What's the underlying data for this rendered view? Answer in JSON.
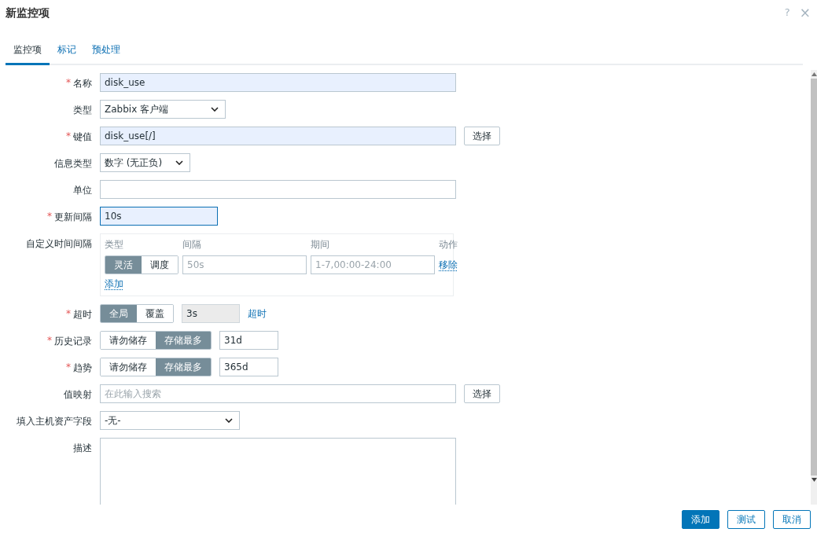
{
  "dialog": {
    "title": "新监控项",
    "help": "?",
    "close": "×"
  },
  "tabs": [
    {
      "label": "监控项",
      "selected": true
    },
    {
      "label": "标记",
      "selected": false
    },
    {
      "label": "预处理",
      "selected": false
    }
  ],
  "fields": [
    {
      "kind": "text",
      "label": "名称",
      "required_mark": "*",
      "value": "disk_use",
      "autofilled": true,
      "focused": false
    },
    {
      "kind": "select",
      "label": "类型",
      "value": "Zabbix 客户端"
    },
    {
      "kind": "text",
      "label": "键值",
      "required_mark": "*",
      "value": "disk_use[/]",
      "autofilled": true,
      "focused": false,
      "button": "选择"
    },
    {
      "kind": "select",
      "label": "信息类型",
      "value": "数字 (无正负)"
    },
    {
      "kind": "text",
      "label": "单位",
      "autofilled": false,
      "focused": false
    },
    {
      "kind": "text",
      "label": "更新间隔",
      "required_mark": "*",
      "value": "10s",
      "autofilled": true,
      "focused": true
    },
    {
      "kind": "intervals",
      "label": "自定义时间间隔",
      "headers": [
        "类型",
        "间隔",
        "期间",
        "动作"
      ],
      "rows": [
        {
          "options": [
            {
              "label": "灵活",
              "selected": true
            },
            {
              "label": "调度",
              "selected": false
            }
          ],
          "interval_placeholder": "50s",
          "period_placeholder": "1-7,00:00-24:00",
          "remove": "移除"
        }
      ],
      "add": "添加"
    },
    {
      "kind": "segmented",
      "label": "超时",
      "required_mark": "*",
      "options": [
        {
          "label": "全局",
          "selected": true
        },
        {
          "label": "覆盖",
          "selected": false
        }
      ],
      "value": "3s",
      "disabled": true,
      "link": "超时"
    },
    {
      "kind": "segmented",
      "label": "历史记录",
      "required_mark": "*",
      "options": [
        {
          "label": "请勿储存",
          "selected": false
        },
        {
          "label": "存储最多",
          "selected": true
        }
      ],
      "value": "31d",
      "disabled": false
    },
    {
      "kind": "segmented",
      "label": "趋势",
      "required_mark": "*",
      "options": [
        {
          "label": "请勿储存",
          "selected": false
        },
        {
          "label": "存储最多",
          "selected": true
        }
      ],
      "value": "365d",
      "disabled": false
    },
    {
      "kind": "text",
      "label": "值映射",
      "placeholder": "在此输入搜索",
      "autofilled": false,
      "focused": false,
      "button": "选择"
    },
    {
      "kind": "select",
      "label": "填入主机资产字段",
      "value": "-无-"
    },
    {
      "kind": "textarea",
      "label": "描述"
    }
  ],
  "buttons": [
    {
      "label": "添加",
      "primary": true
    },
    {
      "label": "测试",
      "primary": false
    },
    {
      "label": "取消",
      "primary": false
    }
  ]
}
